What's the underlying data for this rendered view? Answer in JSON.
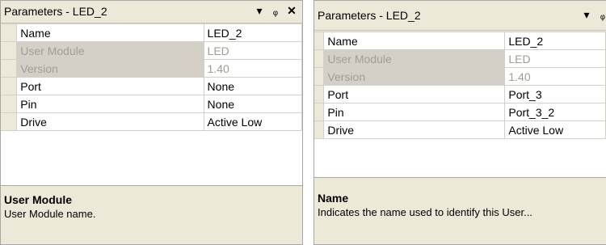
{
  "panels": [
    {
      "title": "Parameters - LED_2",
      "buttons": {
        "dropdown": "▾",
        "pin": "ᵩ",
        "close": "✕"
      },
      "rows": [
        {
          "name": "Name",
          "value": "LED_2",
          "readonly": false
        },
        {
          "name": "User Module",
          "value": "LED",
          "readonly": true
        },
        {
          "name": "Version",
          "value": "1.40",
          "readonly": true
        },
        {
          "name": "Port",
          "value": "None",
          "readonly": false
        },
        {
          "name": "Pin",
          "value": "None",
          "readonly": false
        },
        {
          "name": "Drive",
          "value": "Active Low",
          "readonly": false
        }
      ],
      "description": {
        "heading": "User Module",
        "text": "User Module name."
      }
    },
    {
      "title": "Parameters - LED_2",
      "buttons": {
        "dropdown": "▾",
        "pin": "ᵩ",
        "close": "✕"
      },
      "rows": [
        {
          "name": "Name",
          "value": "LED_2",
          "readonly": false
        },
        {
          "name": "User Module",
          "value": "LED",
          "readonly": true
        },
        {
          "name": "Version",
          "value": "1.40",
          "readonly": true
        },
        {
          "name": "Port",
          "value": "Port_3",
          "readonly": false
        },
        {
          "name": "Pin",
          "value": "Port_3_2",
          "readonly": false
        },
        {
          "name": "Drive",
          "value": "Active Low",
          "readonly": false
        }
      ],
      "description": {
        "heading": "Name",
        "text": "Indicates the name used to identify this User..."
      }
    }
  ]
}
